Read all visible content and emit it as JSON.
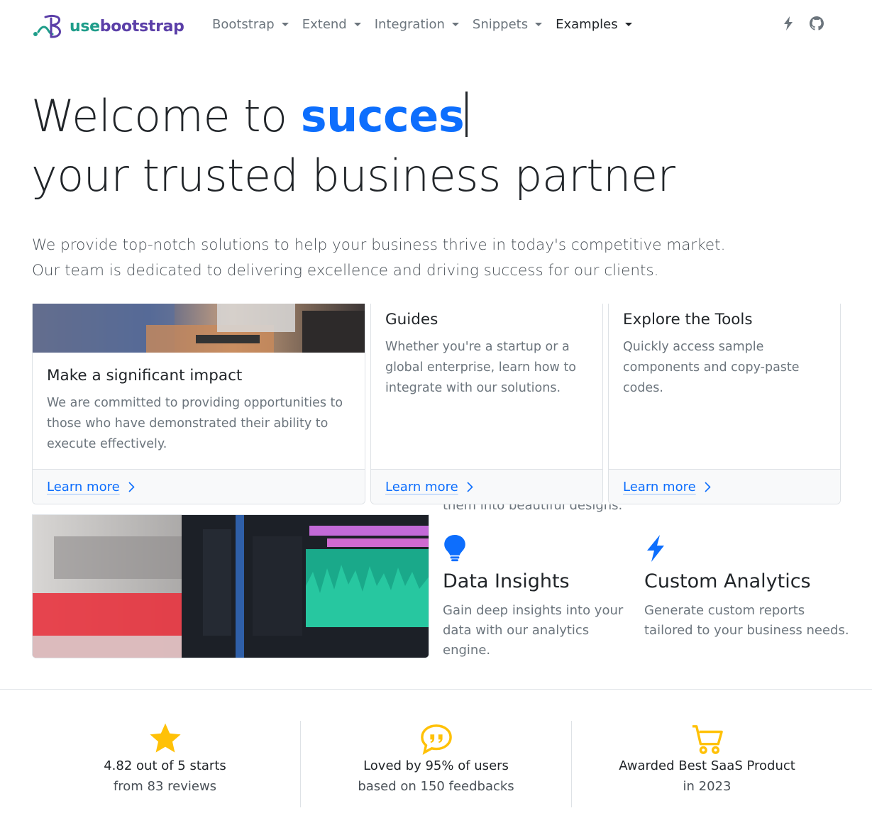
{
  "brand": {
    "prefix": "use",
    "suffix": "bootstrap"
  },
  "nav": {
    "items": [
      {
        "label": "Bootstrap"
      },
      {
        "label": "Extend"
      },
      {
        "label": "Integration"
      },
      {
        "label": "Snippets"
      },
      {
        "label": "Examples"
      }
    ],
    "icons": [
      "lightning-icon",
      "github-icon"
    ]
  },
  "hero": {
    "title_prefix": "Welcome to ",
    "title_typed": "succes",
    "title_line2": "your trusted business partner",
    "sub_line1": "We provide top-notch solutions to help your business thrive in today's competitive market.",
    "sub_line2": "Our team is dedicated to delivering excellence and driving success for our clients."
  },
  "cards": [
    {
      "title": "Make a significant impact",
      "text": "We are committed to providing opportunities to those who have demonstrated their ability to execute effectively.",
      "link": "Learn more"
    },
    {
      "title": "Guides",
      "text": "Whether you're a startup or a global enterprise, learn how to integrate with our solutions.",
      "link": "Learn more"
    },
    {
      "title": "Explore the Tools",
      "text": "Quickly access sample components and copy-paste codes.",
      "link": "Learn more"
    }
  ],
  "features": {
    "cut_text": "them into beautiful designs.",
    "items": [
      {
        "icon": "lightbulb-icon",
        "title": "Data Insights",
        "text_line1": "Gain deep insights into your",
        "text_line2": "data with our analytics engine."
      },
      {
        "icon": "lightning-icon",
        "title": "Custom Analytics",
        "text_line1": "Generate custom reports",
        "text_line2": "tailored to your business needs."
      }
    ]
  },
  "stats": [
    {
      "icon": "star-icon",
      "line1": "4.82 out of 5 starts",
      "line2": "from 83 reviews"
    },
    {
      "icon": "quote-bubble-icon",
      "line1": "Loved by 95% of users",
      "line2": "based on 150 feedbacks"
    },
    {
      "icon": "cart-icon",
      "line1": "Awarded Best SaaS Product",
      "line2": "in 2023"
    }
  ],
  "colors": {
    "primary": "#0d6efd",
    "accent_yellow": "#ffc107",
    "brand_teal": "#1f9d8a",
    "brand_purple": "#5b3fa8"
  }
}
